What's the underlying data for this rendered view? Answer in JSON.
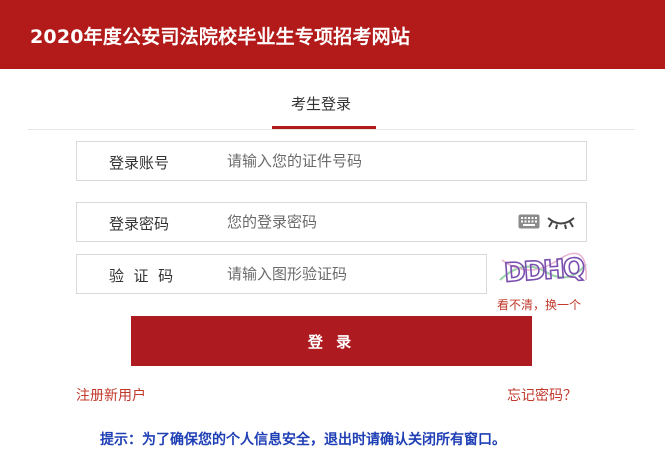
{
  "header": {
    "title": "2020年度公安司法院校毕业生专项招考网站"
  },
  "tab": {
    "label": "考生登录"
  },
  "form": {
    "account_label": "登录账号",
    "account_placeholder": "请输入您的证件号码",
    "password_label": "登录密码",
    "password_placeholder": "您的登录密码",
    "captcha_label": "验  证  码",
    "captcha_placeholder": "请输入图形验证码",
    "captcha_text": "DDHQ",
    "captcha_refresh": "看不清，换一个"
  },
  "buttons": {
    "login": "登 录"
  },
  "links": {
    "register": "注册新用户",
    "forgot": "忘记密码？"
  },
  "tip": "提示：为了确保您的个人信息安全，退出时请确认关闭所有窗口。",
  "colors": {
    "brand": "#b31b1b",
    "button": "#ad1a1f",
    "link": "#c0392b",
    "tip": "#1f3fb5"
  },
  "icons": {
    "keyboard": "keyboard-icon",
    "eye": "eye-closed-icon"
  }
}
